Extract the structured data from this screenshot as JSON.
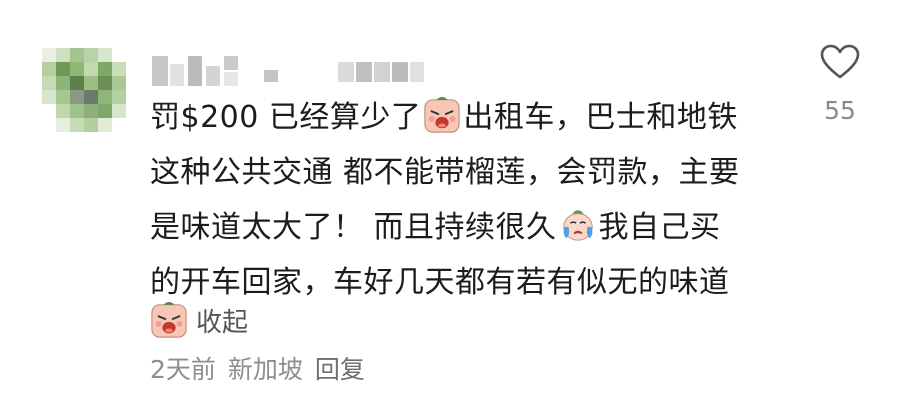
{
  "comment": {
    "lines": [
      [
        "罚$200 已经算少了",
        "出租车，巴士和地铁"
      ],
      [
        "这种公共交通 都不能带榴莲，会罚款，主要"
      ],
      [
        "是味道太大了！ 而且持续很久",
        "我自己买"
      ],
      [
        "的开车回家，车好几天都有若有似无的味道"
      ]
    ],
    "collapse_label": "收起"
  },
  "meta": {
    "time": "2天前",
    "location": "新加坡",
    "reply_label": "回复"
  },
  "like": {
    "count": "55",
    "icon": "heart-outline-icon"
  },
  "icons": {
    "emoji_1": "crying-face-emoji",
    "emoji_2": "tearful-face-emoji",
    "emoji_3": "crying-face-emoji"
  },
  "colors": {
    "text": "#1c1c1c",
    "muted": "#8e8e8e",
    "heart_stroke": "#555555"
  }
}
